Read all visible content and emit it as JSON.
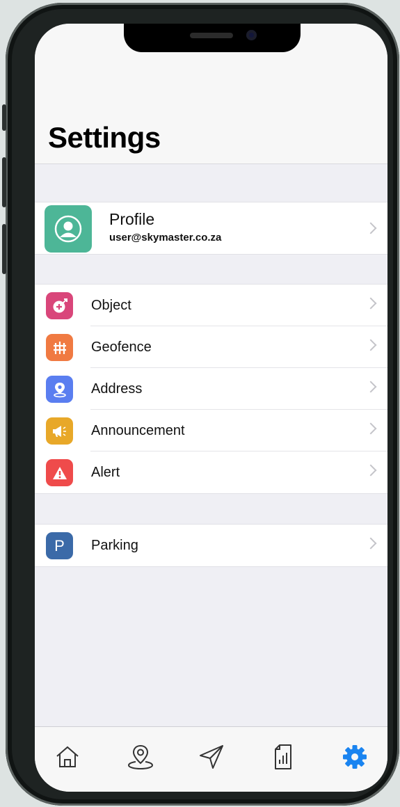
{
  "header": {
    "title": "Settings"
  },
  "profile": {
    "name": "Profile",
    "email": "user@skymaster.co.za",
    "icon": "user-avatar-icon",
    "color": "#4db697"
  },
  "menu": {
    "items": [
      {
        "label": "Object",
        "icon": "object-add-icon",
        "color": "#d9467a"
      },
      {
        "label": "Geofence",
        "icon": "fence-icon",
        "color": "#f07a42"
      },
      {
        "label": "Address",
        "icon": "location-pin-icon",
        "color": "#5a7ef0"
      },
      {
        "label": "Announcement",
        "icon": "megaphone-icon",
        "color": "#e8a829"
      },
      {
        "label": "Alert",
        "icon": "warning-icon",
        "color": "#ef4b4b"
      }
    ]
  },
  "parking": {
    "label": "Parking",
    "icon_text": "P",
    "icon": "parking-icon",
    "color": "#3b6aa8"
  },
  "tabbar": {
    "tabs": [
      {
        "name": "home",
        "icon": "home-icon"
      },
      {
        "name": "places",
        "icon": "map-pin-icon"
      },
      {
        "name": "navigation",
        "icon": "navigation-arrow-icon"
      },
      {
        "name": "reports",
        "icon": "report-document-icon"
      },
      {
        "name": "settings",
        "icon": "gear-icon",
        "active": true,
        "color": "#1a84f0"
      }
    ]
  }
}
